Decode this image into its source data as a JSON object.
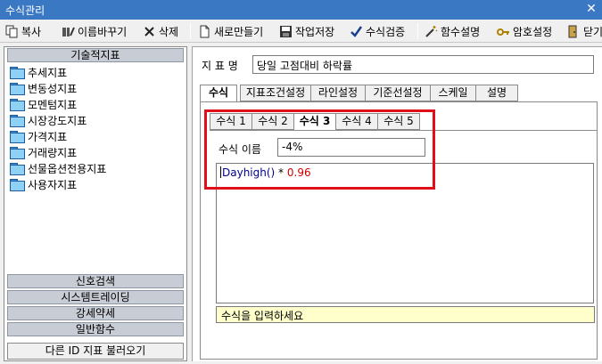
{
  "window": {
    "title": "수식관리",
    "close_glyph": "✕"
  },
  "toolbar": {
    "copy": "복사",
    "rename": "이름바꾸기",
    "delete": "삭제",
    "new": "새로만들기",
    "save": "작업저장",
    "verify": "수식검증",
    "func_help": "함수설명",
    "password": "암호설정",
    "close": "닫기"
  },
  "sidebar": {
    "header": "기술적지표",
    "items": [
      "추세지표",
      "변동성지표",
      "모멘텀지표",
      "시장강도지표",
      "가격지표",
      "거래량지표",
      "선물옵션전용지표",
      "사용자지표"
    ],
    "sections": [
      "신호검색",
      "시스템트레이딩",
      "강세약세",
      "일반함수"
    ],
    "load_other": "다른 ID 지표 불러오기"
  },
  "form": {
    "indicator_label": "지 표 명",
    "indicator_value": "당일 고점대비 하락률",
    "outer_tabs": [
      "수식",
      "지표조건설정",
      "라인설정",
      "기준선설정",
      "스케일",
      "설명"
    ],
    "inner_tabs": [
      "수식 1",
      "수식 2",
      "수식 3",
      "수식 4",
      "수식 5"
    ],
    "formula_name_label": "수식 이름",
    "formula_name_value": "-4%",
    "formula": {
      "function": "Dayhigh()",
      "operator": " * ",
      "number": "0.96"
    },
    "hint": "수식을 입력하세요"
  },
  "colors": {
    "titlebar": "#3a78c4",
    "highlight": "#e0101a",
    "hint_bg": "#ffffcc",
    "number": "#d00000",
    "function": "#00008b"
  }
}
